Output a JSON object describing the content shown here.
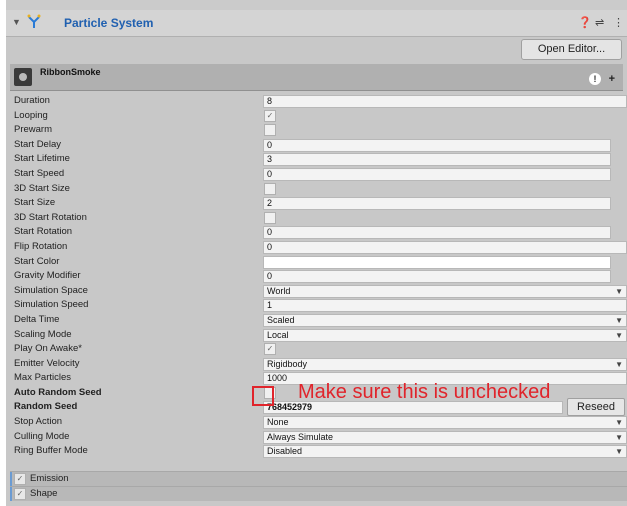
{
  "component": {
    "title": "Particle System",
    "open_editor_label": "Open Editor...",
    "help_icon": "question-circle-icon",
    "settings_icon": "sliders-icon",
    "more_icon": "kebab-menu-icon"
  },
  "module": {
    "name": "RibbonSmoke"
  },
  "fields": [
    {
      "label": "Duration",
      "value": "8"
    },
    {
      "label": "Looping",
      "value": "✓"
    },
    {
      "label": "Prewarm",
      "value": ""
    },
    {
      "label": "Start Delay",
      "value": "0"
    },
    {
      "label": "Start Lifetime",
      "value": "3"
    },
    {
      "label": "Start Speed",
      "value": "0"
    },
    {
      "label": "3D Start Size",
      "value": ""
    },
    {
      "label": "Start Size",
      "value": "2"
    },
    {
      "label": "3D Start Rotation",
      "value": ""
    },
    {
      "label": "Start Rotation",
      "value": "0"
    },
    {
      "label": "Flip Rotation",
      "value": "0"
    },
    {
      "label": "Start Color",
      "value": ""
    },
    {
      "label": "Gravity Modifier",
      "value": "0"
    },
    {
      "label": "Simulation Space",
      "value": "World"
    },
    {
      "label": "Simulation Speed",
      "value": "1"
    },
    {
      "label": "Delta Time",
      "value": "Scaled"
    },
    {
      "label": "Scaling Mode",
      "value": "Local"
    },
    {
      "label": "Play On Awake*",
      "value": "✓"
    },
    {
      "label": "Emitter Velocity",
      "value": "Rigidbody"
    },
    {
      "label": "Max Particles",
      "value": "1000"
    },
    {
      "label": "Auto Random Seed",
      "value": ""
    },
    {
      "label": "Random Seed",
      "value": "768452979",
      "button": "Reseed"
    },
    {
      "label": "Stop Action",
      "value": "None"
    },
    {
      "label": "Culling Mode",
      "value": "Always Simulate"
    },
    {
      "label": "Ring Buffer Mode",
      "value": "Disabled"
    }
  ],
  "sections": [
    {
      "label": "Emission",
      "checked": "✓"
    },
    {
      "label": "Shape",
      "checked": "✓"
    }
  ],
  "annotation": {
    "text": "Make sure this is unchecked",
    "color": "#e0242b"
  }
}
